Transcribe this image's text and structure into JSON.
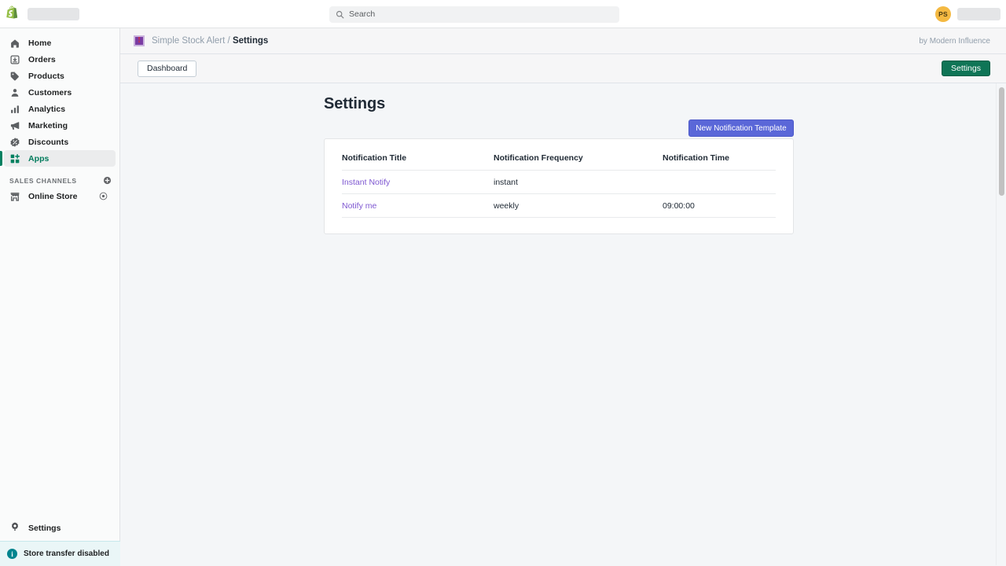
{
  "topbar": {
    "logo_icon": "shopify-bag-icon",
    "store_name_placeholder": "",
    "search": {
      "icon": "search-icon",
      "placeholder": "Search",
      "value": ""
    },
    "avatar_initials": "PS",
    "account_placeholder": ""
  },
  "sidebar": {
    "items": [
      {
        "label": "Home",
        "icon": "home-icon",
        "active": false
      },
      {
        "label": "Orders",
        "icon": "orders-icon",
        "active": false
      },
      {
        "label": "Products",
        "icon": "tag-icon",
        "active": false
      },
      {
        "label": "Customers",
        "icon": "person-icon",
        "active": false
      },
      {
        "label": "Analytics",
        "icon": "bar-chart-icon",
        "active": false
      },
      {
        "label": "Marketing",
        "icon": "megaphone-icon",
        "active": false
      },
      {
        "label": "Discounts",
        "icon": "discount-icon",
        "active": false
      },
      {
        "label": "Apps",
        "icon": "apps-grid-icon",
        "active": true
      }
    ],
    "sales_channels": {
      "title": "SALES CHANNELS",
      "add_icon": "plus-circle-icon",
      "channels": [
        {
          "label": "Online Store",
          "icon": "storefront-icon",
          "view_icon": "eye-icon"
        }
      ]
    },
    "settings": {
      "label": "Settings",
      "icon": "gear-icon"
    },
    "notice": {
      "label": "Store transfer disabled",
      "icon": "info-icon"
    }
  },
  "app": {
    "icon": "exclamation-square-icon",
    "breadcrumb_app": "Simple Stock Alert",
    "breadcrumb_sep": "/",
    "breadcrumb_current": "Settings",
    "author": "by Modern Influence",
    "toolbar": {
      "dashboard_label": "Dashboard",
      "settings_label": "Settings"
    }
  },
  "main": {
    "title": "Settings",
    "new_template_label": "New Notification Template",
    "table": {
      "columns": [
        "Notification Title",
        "Notification Frequency",
        "Notification Time"
      ],
      "rows": [
        {
          "title": "Instant Notify",
          "frequency": "instant",
          "time": ""
        },
        {
          "title": "Notify me",
          "frequency": "weekly",
          "time": "09:00:00"
        }
      ]
    }
  },
  "colors": {
    "shopify_green": "#008060",
    "settings_button": "#0f7556",
    "primary_button": "#5a67d8",
    "link_purple": "#7e57d1",
    "app_icon_purple": "#7a3ca3",
    "avatar_amber": "#f4b942",
    "notice_teal": "#00848e"
  }
}
